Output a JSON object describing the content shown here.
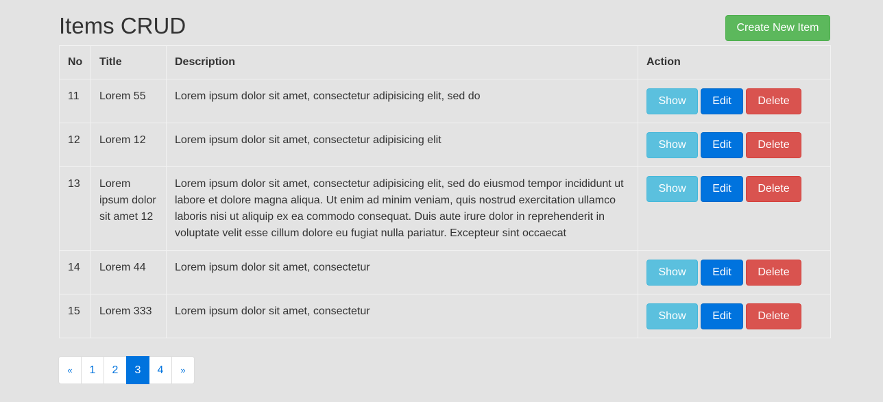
{
  "header": {
    "title": "Items CRUD",
    "create_button": "Create New Item"
  },
  "table": {
    "columns": [
      "No",
      "Title",
      "Description",
      "Action"
    ],
    "rows": [
      {
        "no": "11",
        "title": "Lorem 55",
        "description": "Lorem ipsum dolor sit amet, consectetur adipisicing elit, sed do"
      },
      {
        "no": "12",
        "title": "Lorem 12",
        "description": "Lorem ipsum dolor sit amet, consectetur adipisicing elit"
      },
      {
        "no": "13",
        "title": "Lorem ipsum dolor sit amet 12",
        "description": "Lorem ipsum dolor sit amet, consectetur adipisicing elit, sed do eiusmod tempor incididunt ut labore et dolore magna aliqua. Ut enim ad minim veniam, quis nostrud exercitation ullamco laboris nisi ut aliquip ex ea commodo consequat. Duis aute irure dolor in reprehenderit in voluptate velit esse cillum dolore eu fugiat nulla pariatur. Excepteur sint occaecat"
      },
      {
        "no": "14",
        "title": "Lorem 44",
        "description": "Lorem ipsum dolor sit amet, consectetur"
      },
      {
        "no": "15",
        "title": "Lorem 333",
        "description": "Lorem ipsum dolor sit amet, consectetur"
      }
    ],
    "actions": {
      "show": "Show",
      "edit": "Edit",
      "delete": "Delete"
    }
  },
  "pagination": {
    "prev": "«",
    "pages": [
      "1",
      "2",
      "3",
      "4"
    ],
    "current": "3",
    "next": "»"
  },
  "colors": {
    "background": "#e3e3e3",
    "create": "#5cb85c",
    "show": "#5bc0de",
    "edit": "#0073de",
    "delete": "#d9534f",
    "pagination_active": "#0073de"
  }
}
